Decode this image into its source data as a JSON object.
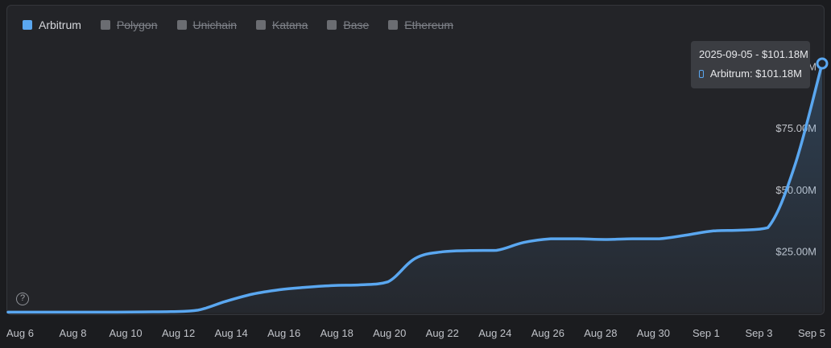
{
  "legend": [
    {
      "label": "Arbitrum",
      "color": "#5aa7f0",
      "active": true
    },
    {
      "label": "Polygon",
      "color": "#6b6d72",
      "active": false
    },
    {
      "label": "Unichain",
      "color": "#6b6d72",
      "active": false
    },
    {
      "label": "Katana",
      "color": "#6b6d72",
      "active": false
    },
    {
      "label": "Base",
      "color": "#6b6d72",
      "active": false
    },
    {
      "label": "Ethereum",
      "color": "#6b6d72",
      "active": false
    }
  ],
  "tooltip": {
    "title": "2025-09-05 - $101.18M",
    "series_label": "Arbitrum: $101.18M"
  },
  "help_icon": {
    "icon": "question-circle-icon",
    "glyph": "?"
  },
  "chart_data": {
    "type": "area",
    "x_tick_labels": [
      "Aug 6",
      "Aug 8",
      "Aug 10",
      "Aug 12",
      "Aug 14",
      "Aug 16",
      "Aug 18",
      "Aug 20",
      "Aug 22",
      "Aug 24",
      "Aug 26",
      "Aug 28",
      "Aug 30",
      "Sep 1",
      "Sep 3",
      "Sep 5"
    ],
    "y_tick_labels": [
      "$25.00M",
      "$50.00M",
      "$75.00M",
      "$100.00M"
    ],
    "y_tick_values": [
      25,
      50,
      75,
      100
    ],
    "ylim": [
      0,
      101.18
    ],
    "y_unit": "$M",
    "series": [
      {
        "name": "Arbitrum",
        "color": "#5aa7f0",
        "x": [
          "2025-08-06",
          "2025-08-07",
          "2025-08-08",
          "2025-08-09",
          "2025-08-10",
          "2025-08-11",
          "2025-08-12",
          "2025-08-13",
          "2025-08-14",
          "2025-08-15",
          "2025-08-16",
          "2025-08-17",
          "2025-08-18",
          "2025-08-19",
          "2025-08-20",
          "2025-08-21",
          "2025-08-22",
          "2025-08-23",
          "2025-08-24",
          "2025-08-25",
          "2025-08-26",
          "2025-08-27",
          "2025-08-28",
          "2025-08-29",
          "2025-08-30",
          "2025-08-31",
          "2025-09-01",
          "2025-09-02",
          "2025-09-03",
          "2025-09-04",
          "2025-09-05"
        ],
        "values": [
          0.2,
          0.2,
          0.2,
          0.2,
          0.2,
          0.3,
          0.4,
          1.0,
          4.5,
          7.5,
          9.3,
          10.3,
          11.0,
          11.3,
          12.5,
          22.0,
          24.7,
          25.2,
          25.3,
          28.5,
          30.0,
          30.0,
          29.7,
          30.0,
          30.0,
          31.5,
          33.2,
          33.5,
          34.5,
          60.0,
          101.18
        ]
      }
    ],
    "highlight": {
      "x": "2025-09-05",
      "value": 101.18
    }
  }
}
